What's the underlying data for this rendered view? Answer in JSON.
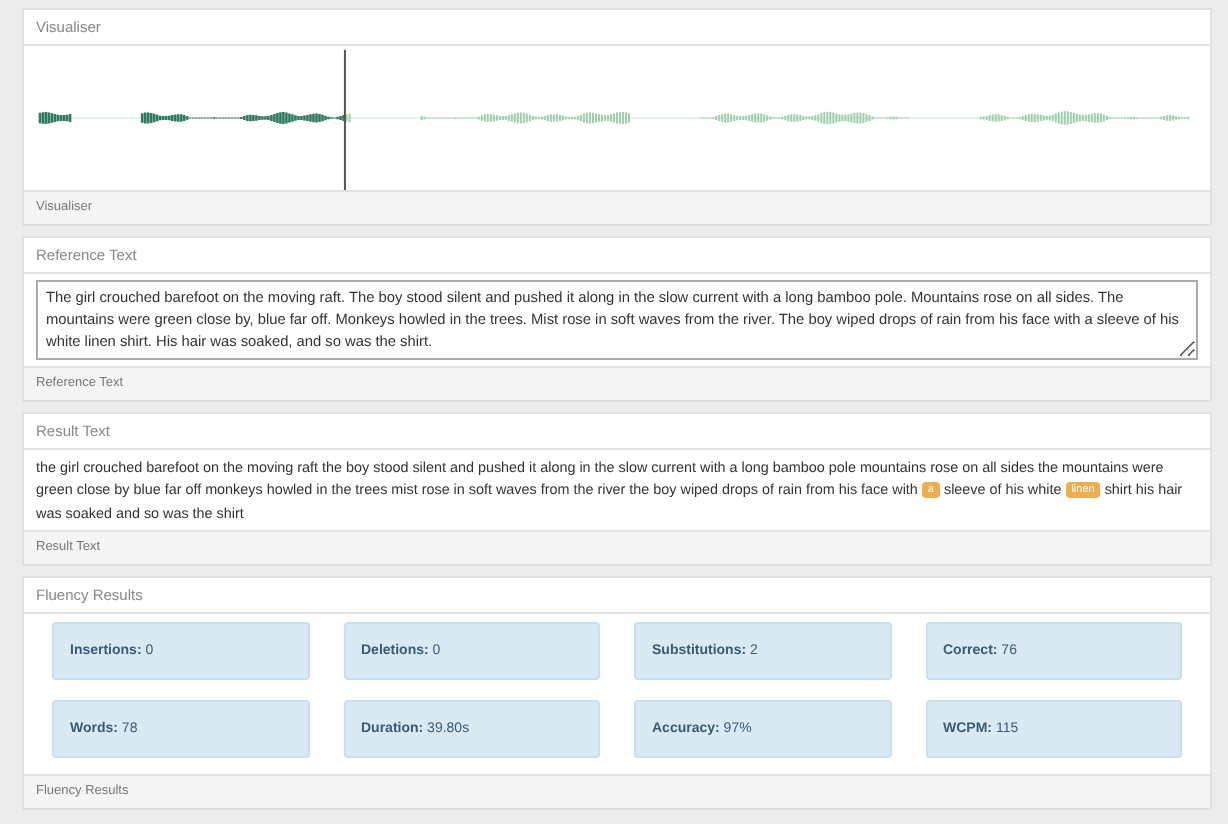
{
  "visualiser": {
    "title": "Visualiser",
    "playback": {
      "level": 0.265
    },
    "footer": "Visualiser"
  },
  "reference_text": {
    "title": "Reference Text",
    "value": "The girl crouched barefoot on the moving raft. The boy stood silent and pushed it along in the slow current with a long bamboo pole. Mountains rose on all sides. The mountains were green close by, blue far off. Monkeys howled in the trees. Mist rose in soft waves from the river. The boy wiped drops of rain from his face with a sleeve of his white linen shirt. His hair was soaked, and so was the shirt.",
    "footer": "Reference Text"
  },
  "result_text": {
    "title": "Result Text",
    "segments": [
      {
        "kind": "text",
        "text": "the girl crouched barefoot on the moving raft the boy stood silent and pushed it along in the slow current with a long bamboo pole mountains rose on all sides the mountains were green close by blue far off monkeys howled in the trees mist rose in soft waves from the river the boy wiped drops of rain from his face with"
      },
      {
        "kind": "highlight",
        "text": "a"
      },
      {
        "kind": "text",
        "text": "sleeve of his white"
      },
      {
        "kind": "highlight",
        "text": "linen"
      },
      {
        "kind": "text",
        "text": "shirt his hair was soaked and so was the shirt"
      }
    ],
    "footer": "Result Text"
  },
  "fluency_results": {
    "title": "Fluency Results",
    "stats": [
      {
        "label": "Insertions:",
        "value": "0"
      },
      {
        "label": "Deletions:",
        "value": "0"
      },
      {
        "label": "Substitutions:",
        "value": "2"
      },
      {
        "label": "Correct:",
        "value": "76"
      },
      {
        "label": "Words:",
        "value": "78"
      },
      {
        "label": "Duration:",
        "value": "39.80s"
      },
      {
        "label": "Accuracy:",
        "value": "97%"
      },
      {
        "label": "WCPM:",
        "value": "115"
      }
    ],
    "footer": "Fluency Results"
  }
}
